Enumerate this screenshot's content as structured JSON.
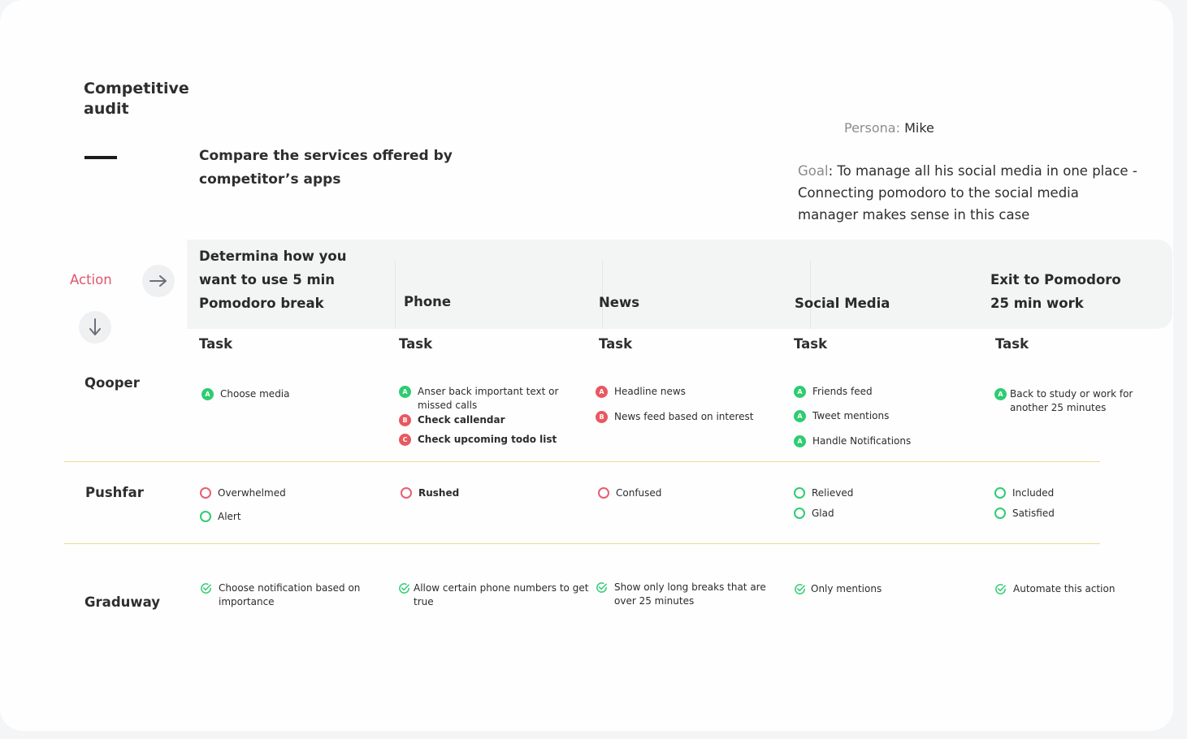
{
  "title": "Competitive audit",
  "subtitle": "Compare the services offered by competitor’s apps",
  "persona": {
    "label": "Persona:",
    "value": "Mike"
  },
  "goal": {
    "label": "Goal",
    "text": ": To manage all his social media in one place - Connecting pomodoro to the social media manager makes sense in this case"
  },
  "action_label": "Action",
  "columns": [
    {
      "header": "Determina how you want to use 5 min Pomodoro break",
      "task": "Task"
    },
    {
      "header": "Phone",
      "task": "Task"
    },
    {
      "header": "News",
      "task": "Task"
    },
    {
      "header": "Social Media",
      "task": "Task"
    },
    {
      "header": "Exit to Pomodoro 25 min work",
      "task": "Task"
    }
  ],
  "rows": {
    "qooper": {
      "label": "Qooper",
      "cells": [
        [
          {
            "badge": "A",
            "text": "Choose media"
          }
        ],
        [
          {
            "badge": "A",
            "text": "Anser back important text or missed calls"
          },
          {
            "badge": "B",
            "text": "Check callendar"
          },
          {
            "badge": "C",
            "text": "Check upcoming todo list"
          }
        ],
        [
          {
            "badge": "A",
            "text": "Headline news"
          },
          {
            "badge": "B",
            "text": "News feed based on interest"
          }
        ],
        [
          {
            "badge": "A",
            "text": "Friends feed"
          },
          {
            "badge": "A",
            "text": "Tweet mentions"
          },
          {
            "badge": "A",
            "text": "Handle Notifications"
          }
        ],
        [
          {
            "badge": "A",
            "text": "Back to study or work for another 25 minutes"
          }
        ]
      ]
    },
    "pushfar": {
      "label": "Pushfar",
      "cells": [
        [
          {
            "text": "Overwhelmed"
          },
          {
            "text": "Alert"
          }
        ],
        [
          {
            "text": "Rushed"
          }
        ],
        [
          {
            "text": "Confused"
          }
        ],
        [
          {
            "text": "Relieved"
          },
          {
            "text": "Glad"
          }
        ],
        [
          {
            "text": "Included"
          },
          {
            "text": "Satisfied"
          }
        ]
      ]
    },
    "graduway": {
      "label": "Graduway",
      "cells": [
        [
          {
            "text": "Choose notification based on importance"
          }
        ],
        [
          {
            "text": "Allow certain phone numbers to get true"
          }
        ],
        [
          {
            "text": "Show only long breaks that are over 25 minutes"
          }
        ],
        [
          {
            "text": "Only mentions"
          }
        ],
        [
          {
            "text": "Automate this action"
          }
        ]
      ]
    }
  },
  "colors": {
    "accent_red": "#e0566d",
    "positive_green": "#2ecc71",
    "divider_gold": "#f0d98e"
  }
}
